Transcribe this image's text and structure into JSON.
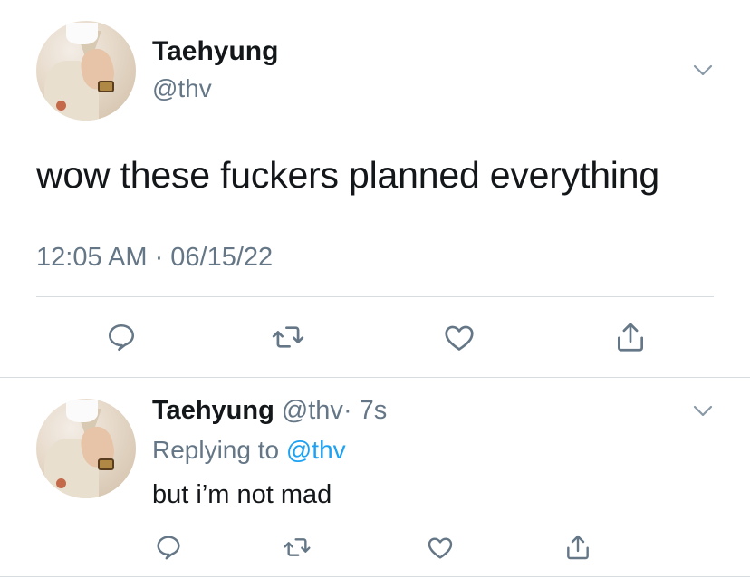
{
  "main_tweet": {
    "display_name": "Taehyung",
    "handle": "@thv",
    "text": "wow these fuckers planned everything",
    "timestamp": "12:05 AM · 06/15/22",
    "icons": {
      "reply": "comment-icon",
      "retweet": "retweet-icon",
      "like": "heart-icon",
      "share": "share-icon",
      "menu": "chevron-down-icon"
    }
  },
  "reply_tweet": {
    "display_name": "Taehyung",
    "handle": "@thv",
    "time": "· 7s",
    "replying_to_label": "Replying to ",
    "replying_to_handle": "@thv",
    "text": "but i’m not mad"
  },
  "colors": {
    "text_primary": "#14171a",
    "text_secondary": "#657786",
    "accent": "#1da1f2",
    "divider": "#d6dce0",
    "icon": "#657786"
  }
}
